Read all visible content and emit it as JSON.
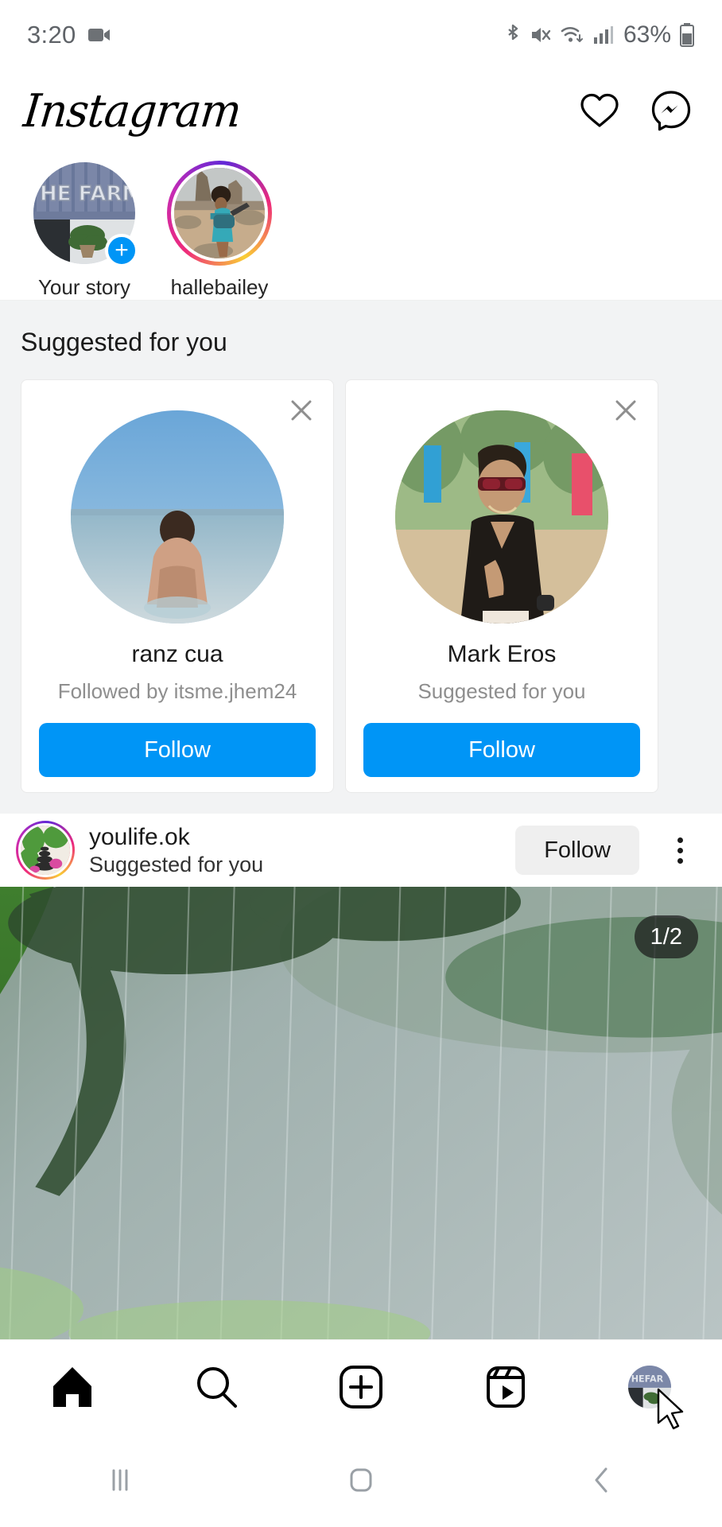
{
  "status_bar": {
    "time": "3:20",
    "battery_percent": "63%",
    "icons": [
      "video-camera-icon",
      "bluetooth-icon",
      "mute-icon",
      "wifi-icon",
      "cellular-signal-icon",
      "battery-icon"
    ]
  },
  "app_header": {
    "logo_text": "Instagram",
    "actions": [
      "heart-icon",
      "messenger-icon"
    ]
  },
  "stories": {
    "items": [
      {
        "label": "Your story",
        "has_add_button": true,
        "has_gradient_ring": false,
        "add_label": "+"
      },
      {
        "label": "hallebailey",
        "has_add_button": false,
        "has_gradient_ring": true,
        "add_label": ""
      }
    ]
  },
  "suggested": {
    "title": "Suggested for you",
    "cards": [
      {
        "name": "ranz cua",
        "subtitle": "Followed by itsme.jhem24",
        "follow_label": "Follow",
        "close_label": "×"
      },
      {
        "name": "Mark Eros",
        "subtitle": "Suggested for you",
        "follow_label": "Follow",
        "close_label": "×"
      }
    ]
  },
  "post": {
    "username": "youlife.ok",
    "subtitle": "Suggested for you",
    "follow_label": "Follow",
    "carousel_indicator": "1/2"
  },
  "bottom_nav": {
    "items": [
      {
        "name": "home",
        "icon": "home-icon",
        "active": true
      },
      {
        "name": "search",
        "icon": "search-icon",
        "active": false
      },
      {
        "name": "create",
        "icon": "plus-square-icon",
        "active": false
      },
      {
        "name": "reels",
        "icon": "reels-icon",
        "active": false
      },
      {
        "name": "profile",
        "icon": "profile-avatar-icon",
        "active": false
      }
    ]
  },
  "system_nav": {
    "items": [
      {
        "name": "recents",
        "icon": "recents-icon",
        "glyph": "|||"
      },
      {
        "name": "home",
        "icon": "home-square-icon",
        "glyph": "▢"
      },
      {
        "name": "back",
        "icon": "back-chevron-icon",
        "glyph": "‹"
      }
    ]
  },
  "colors": {
    "instagram_blue": "#0095F6",
    "section_bg": "#F2F3F4",
    "text_primary": "#1A1A1A",
    "text_secondary": "#8E8E8E",
    "button_gray": "#EFEFEF"
  }
}
